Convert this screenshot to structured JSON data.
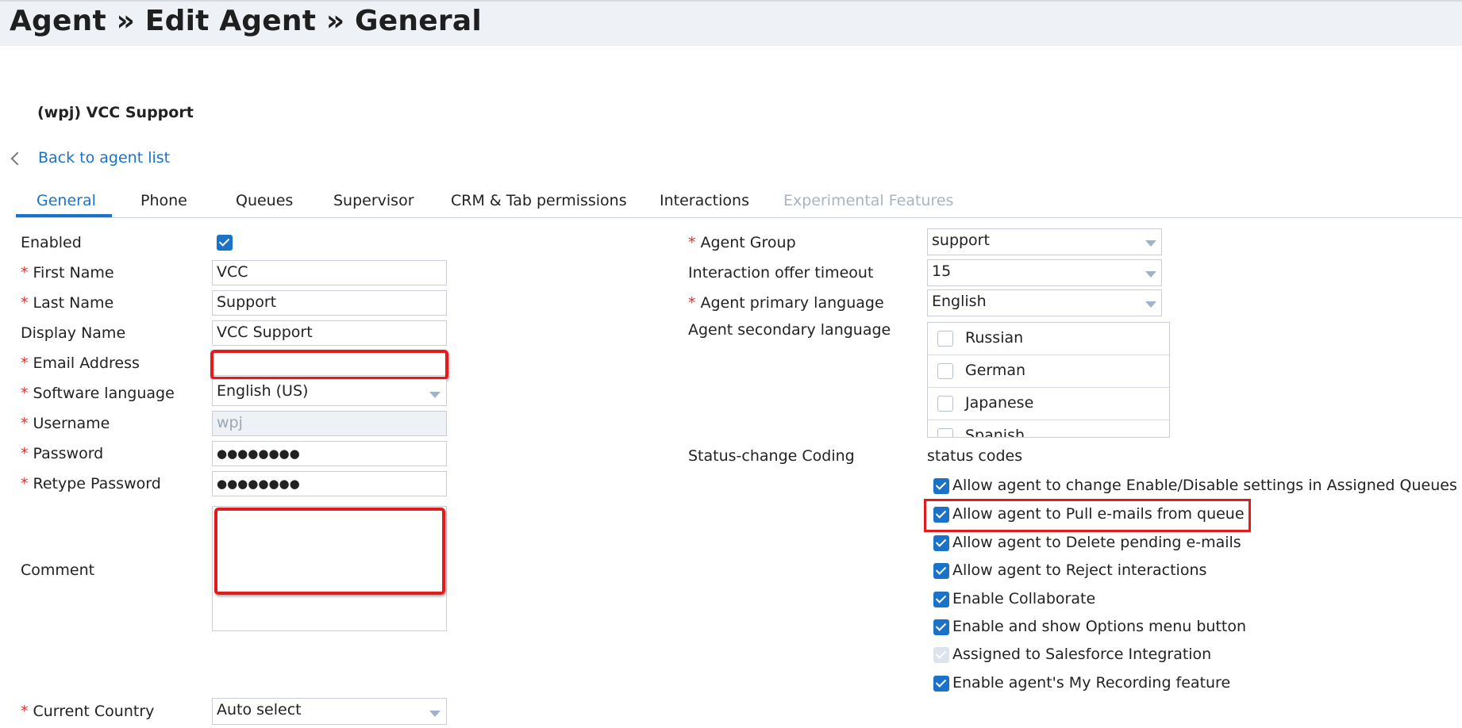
{
  "page": {
    "title": "Agent » Edit Agent » General"
  },
  "agent_name": "(wpj) VCC Support",
  "back_link": "Back to agent list",
  "tabs": [
    {
      "label": "General",
      "active": true
    },
    {
      "label": "Phone"
    },
    {
      "label": "Queues"
    },
    {
      "label": "Supervisor"
    },
    {
      "label": "CRM & Tab permissions"
    },
    {
      "label": "Interactions"
    },
    {
      "label": "Experimental Features",
      "disabled": true
    }
  ],
  "left_form": {
    "enabled": {
      "label": "Enabled",
      "checked": true
    },
    "first_name": {
      "label": "First Name",
      "value": "VCC"
    },
    "last_name": {
      "label": "Last Name",
      "value": "Support"
    },
    "display_name": {
      "label": "Display Name",
      "value": "VCC Support"
    },
    "email": {
      "label": "Email Address",
      "value": ""
    },
    "software_language": {
      "label": "Software language",
      "value": "English (US)"
    },
    "username": {
      "label": "Username",
      "value": "wpj"
    },
    "password": {
      "label": "Password",
      "value": "●●●●●●●●"
    },
    "retype_password": {
      "label": "Retype Password",
      "value": "●●●●●●●●"
    },
    "comment": {
      "label": "Comment",
      "value": ""
    },
    "current_country": {
      "label": "Current Country",
      "value": "Auto select"
    }
  },
  "right_form": {
    "agent_group": {
      "label": "Agent Group",
      "value": "support"
    },
    "offer_timeout": {
      "label": "Interaction offer timeout",
      "value": "15"
    },
    "primary_language": {
      "label": "Agent primary language",
      "value": "English"
    },
    "secondary_language": {
      "label": "Agent secondary language",
      "options": [
        "Russian",
        "German",
        "Japanese",
        "Spanish"
      ]
    },
    "status_coding": {
      "label": "Status-change Coding",
      "value": "status codes"
    }
  },
  "permissions": [
    {
      "text": "Allow agent to change Enable/Disable settings in Assigned Queues",
      "checked": true
    },
    {
      "text": "Allow agent to Pull e-mails from queue",
      "checked": true
    },
    {
      "text": "Allow agent to Delete pending e-mails",
      "checked": true
    },
    {
      "text": "Allow agent to Reject interactions",
      "checked": true
    },
    {
      "text": "Enable Collaborate",
      "checked": true
    },
    {
      "text": "Enable and show Options menu button",
      "checked": true
    },
    {
      "text": "Assigned to Salesforce Integration",
      "checked": true,
      "disabled": true
    },
    {
      "text": "Enable agent's My Recording feature",
      "checked": true
    }
  ],
  "colors": {
    "accent": "#1a73c8",
    "required": "#e03030",
    "highlight": "#e31b1b"
  }
}
